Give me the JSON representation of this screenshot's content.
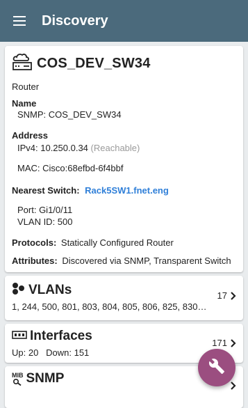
{
  "appbar": {
    "title": "Discovery",
    "menu_icon": "hamburger-menu-icon"
  },
  "device": {
    "name": "COS_DEV_SW34",
    "icon": "router-device-icon",
    "type": "Router",
    "name_label": "Name",
    "snmp_name": "SNMP: COS_DEV_SW34",
    "address_label": "Address",
    "ipv4": "IPv4: 10.250.0.34",
    "reachable": "(Reachable)",
    "mac": "MAC: Cisco:68efbd-6f4bbf",
    "nearest_switch_label": "Nearest Switch:",
    "nearest_switch": "Rack5SW1.fnet.eng",
    "port": "Port: Gi1/0/11",
    "vlan_id": "VLAN ID: 500",
    "protocols_label": "Protocols:",
    "protocols": "Statically Configured Router",
    "attributes_label": "Attributes:",
    "attributes": "Discovered via SNMP, Transparent Switch"
  },
  "vlans": {
    "title": "VLANs",
    "icon": "vlans-icon",
    "list": "1, 244, 500, 801, 803, 804, 805, 806, 825, 830…",
    "count": "17"
  },
  "interfaces": {
    "title": "Interfaces",
    "icon": "interfaces-icon",
    "status": "Up: 20   Down: 151",
    "count": "171"
  },
  "snmp": {
    "title": "SNMP",
    "icon": "mib-icon",
    "icon_text": "MIB"
  },
  "fab": {
    "icon": "wrench-icon"
  },
  "colors": {
    "appbar": "#4b6a7c",
    "link": "#2f7fd8",
    "fab": "#9b4e80"
  }
}
